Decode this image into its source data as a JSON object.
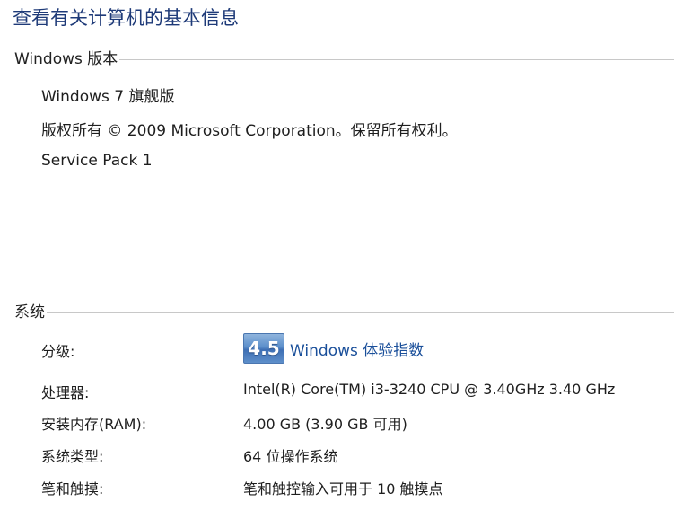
{
  "page_title": "查看有关计算机的基本信息",
  "windows_edition": {
    "header": "Windows 版本",
    "edition": "Windows 7 旗舰版",
    "copyright": "版权所有 © 2009 Microsoft Corporation。保留所有权利。",
    "service_pack": "Service Pack 1"
  },
  "system": {
    "header": "系统",
    "rating": {
      "label": "分级:",
      "score": "4.5",
      "link_text": "Windows 体验指数"
    },
    "rows": [
      {
        "label": "处理器:",
        "value": "Intel(R) Core(TM) i3-3240 CPU @ 3.40GHz   3.40 GHz"
      },
      {
        "label": "安装内存(RAM):",
        "value": "4.00 GB (3.90 GB 可用)"
      },
      {
        "label": "系统类型:",
        "value": "64 位操作系统"
      },
      {
        "label": "笔和触摸:",
        "value": "笔和触控输入可用于 10 触摸点"
      }
    ]
  },
  "colors": {
    "title": "#1e3a78",
    "link": "#1a4f9a",
    "badge": "#5c8fcb"
  }
}
